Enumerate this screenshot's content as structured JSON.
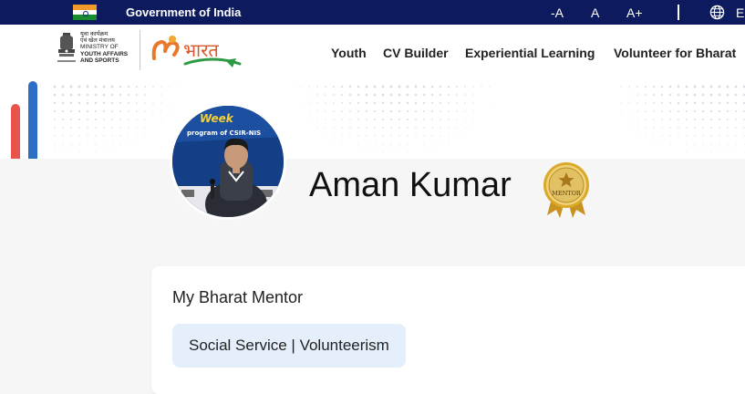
{
  "gov_bar": {
    "title": "Government of India",
    "font_small": "-A",
    "font_normal": "A",
    "font_large": "A+",
    "language_partial": "E",
    "icons": [
      "india-flag-icon",
      "globe-icon"
    ]
  },
  "header": {
    "ministry_hindi_1": "युवा कार्यक्रम",
    "ministry_hindi_2": "एवं खेल मंत्रालय",
    "ministry_1": "MINISTRY OF",
    "ministry_2": "YOUTH AFFAIRS",
    "ministry_3": "AND SPORTS",
    "emblem_caption": "सत्यमेव जयते",
    "nav": {
      "youth": "Youth",
      "cv_builder": "CV Builder",
      "experiential_learning": "Experiential Learning",
      "volunteer": "Volunteer for Bharat"
    }
  },
  "profile": {
    "name": "Aman Kumar",
    "badge_text": "MENTOR",
    "avatar_banner_text_1": "Week",
    "avatar_banner_text_2": "program of CSIR-NIS"
  },
  "card": {
    "title": "My Bharat Mentor",
    "tag": "Social Service | Volunteerism"
  },
  "colors": {
    "gov_bar_bg": "#0d1b5e",
    "chip_bg": "#e4effb",
    "stripe_blue": "#2d6fc5",
    "stripe_red": "#e8544a",
    "badge_gold": "#d9a92a"
  }
}
